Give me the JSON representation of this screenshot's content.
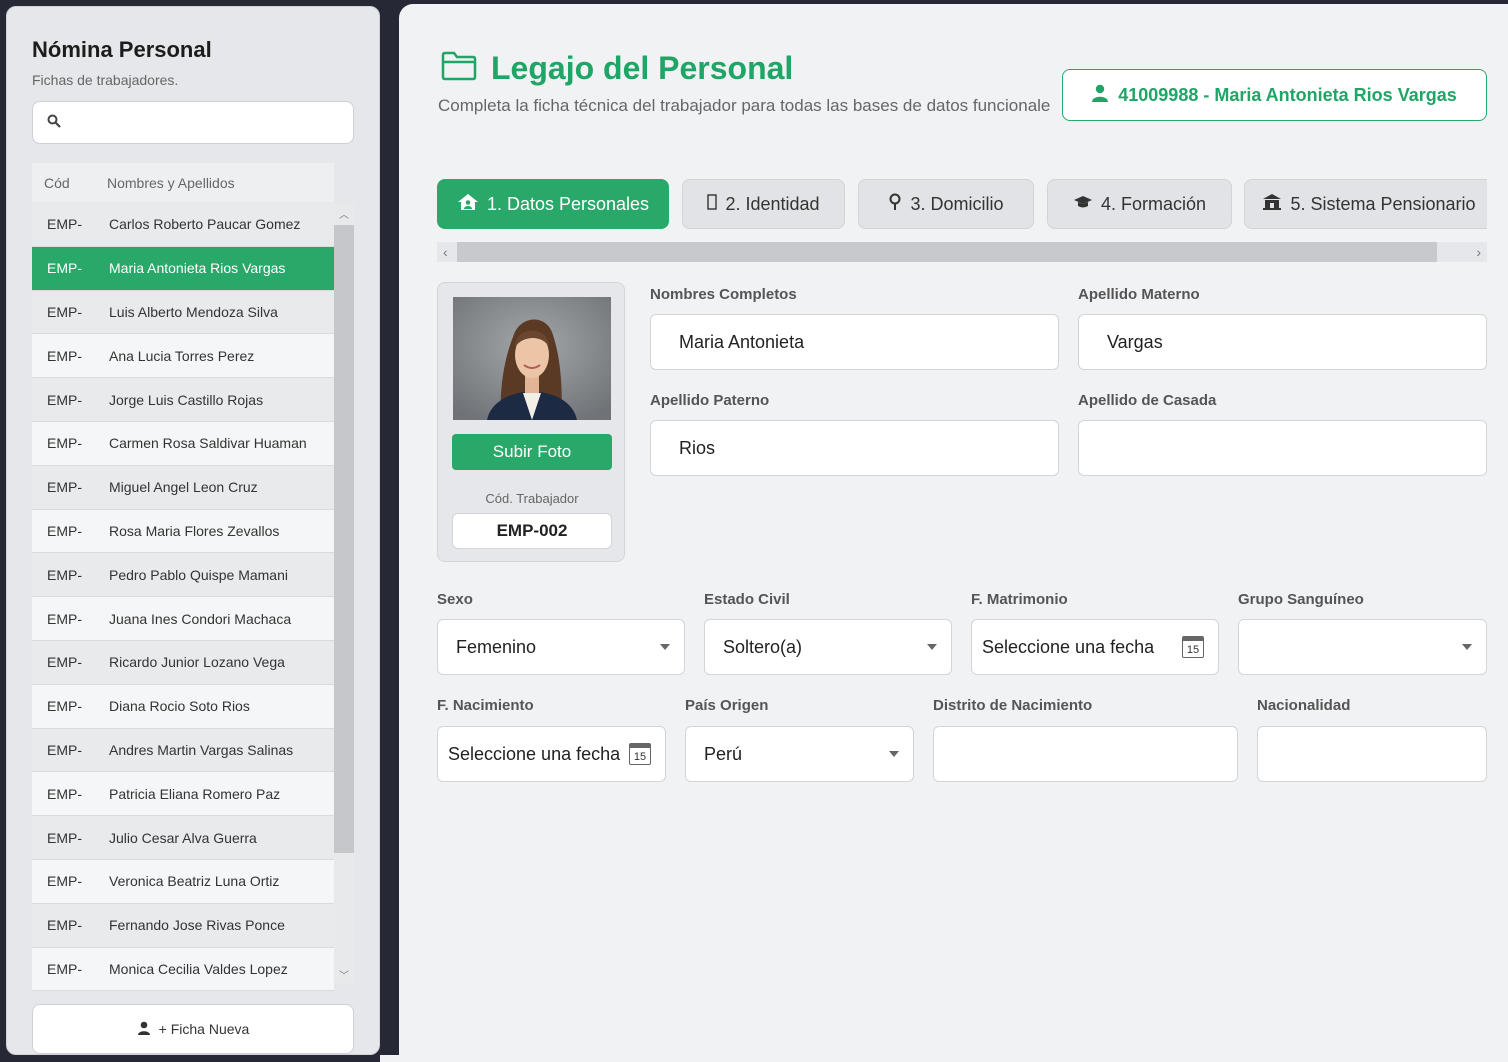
{
  "sidebar": {
    "title": "Nómina Personal",
    "subtitle": "Fichas de trabajadores.",
    "search": {
      "placeholder": "",
      "icon": "search-icon"
    },
    "table": {
      "headers": [
        "Cód",
        "Nombres y Apellidos"
      ],
      "rows": [
        {
          "code": "EMP-",
          "name": "Carlos Roberto Paucar Gomez"
        },
        {
          "code": "EMP-",
          "name": "Maria Antonieta Rios Vargas",
          "selected": true
        },
        {
          "code": "EMP-",
          "name": "Luis Alberto Mendoza Silva"
        },
        {
          "code": "EMP-",
          "name": "Ana Lucia Torres Perez"
        },
        {
          "code": "EMP-",
          "name": "Jorge Luis Castillo Rojas"
        },
        {
          "code": "EMP-",
          "name": "Carmen Rosa Saldivar Huaman"
        },
        {
          "code": "EMP-",
          "name": "Miguel Angel Leon Cruz"
        },
        {
          "code": "EMP-",
          "name": "Rosa Maria Flores Zevallos"
        },
        {
          "code": "EMP-",
          "name": "Pedro Pablo Quispe Mamani"
        },
        {
          "code": "EMP-",
          "name": "Juana Ines Condori Machaca"
        },
        {
          "code": "EMP-",
          "name": "Ricardo Junior Lozano Vega"
        },
        {
          "code": "EMP-",
          "name": "Diana Rocio Soto Rios"
        },
        {
          "code": "EMP-",
          "name": "Andres Martin Vargas Salinas"
        },
        {
          "code": "EMP-",
          "name": "Patricia Eliana Romero Paz"
        },
        {
          "code": "EMP-",
          "name": "Julio Cesar Alva Guerra"
        },
        {
          "code": "EMP-",
          "name": "Veronica Beatriz Luna Ortiz"
        },
        {
          "code": "EMP-",
          "name": "Fernando Jose Rivas Ponce"
        },
        {
          "code": "EMP-",
          "name": "Monica Cecilia Valdes Lopez"
        }
      ]
    },
    "new_button": "+ Ficha Nueva"
  },
  "main": {
    "title": "Legajo del Personal",
    "subtitle": "Completa la ficha técnica del trabajador para todas las bases de datos funcionale",
    "badge": "41009988 - Maria Antonieta Rios Vargas",
    "tabs": [
      {
        "label": "1. Datos Personales",
        "icon": "house-user-icon",
        "active": true
      },
      {
        "label": "2. Identidad",
        "icon": "id-card-icon"
      },
      {
        "label": "3. Domicilio",
        "icon": "map-pin-icon"
      },
      {
        "label": "4. Formación",
        "icon": "graduation-cap-icon"
      },
      {
        "label": "5. Sistema Pensionario",
        "icon": "bank-icon"
      }
    ],
    "photo": {
      "upload_label": "Subir Foto",
      "code_label": "Cód. Trabajador",
      "code": "EMP-002"
    },
    "fields": {
      "nombres": {
        "label": "Nombres Completos",
        "value": "Maria Antonieta"
      },
      "materno": {
        "label": "Apellido Materno",
        "value": "Vargas"
      },
      "paterno": {
        "label": "Apellido Paterno",
        "value": "Rios"
      },
      "casada": {
        "label": "Apellido de Casada",
        "value": ""
      },
      "sexo": {
        "label": "Sexo",
        "value": "Femenino"
      },
      "estado_civil": {
        "label": "Estado Civil",
        "value": "Soltero(a)"
      },
      "f_matrimonio": {
        "label": "F. Matrimonio",
        "value": "Seleccione una fecha",
        "cal": "15"
      },
      "grupo": {
        "label": "Grupo Sanguíneo",
        "value": ""
      },
      "f_nacimiento": {
        "label": "F. Nacimiento",
        "value": "Seleccione una fecha",
        "cal": "15"
      },
      "pais": {
        "label": "País Origen",
        "value": "Perú"
      },
      "distrito": {
        "label": "Distrito de Nacimiento",
        "value": ""
      },
      "nacionalidad": {
        "label": "Nacionalidad",
        "value": ""
      }
    }
  },
  "colors": {
    "accent": "#28a96a",
    "accent_text": "#1fa566",
    "background": "#262836"
  }
}
